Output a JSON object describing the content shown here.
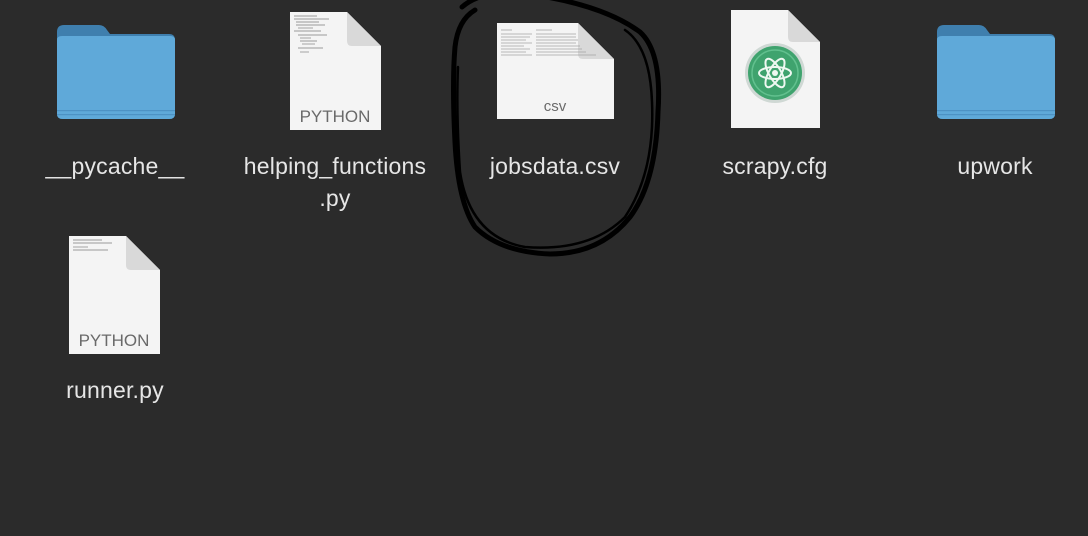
{
  "files": [
    {
      "name": "__pycache__",
      "kind": "folder",
      "icon": "folder-icon"
    },
    {
      "name_line1": "helping_functions",
      "name_line2": ".py",
      "kind": "python",
      "badge": "PYTHON",
      "icon": "python-document-icon"
    },
    {
      "name": "jobsdata.csv",
      "kind": "csv",
      "badge": "csv",
      "icon": "csv-document-icon",
      "annotated": true
    },
    {
      "name": "scrapy.cfg",
      "kind": "cfg",
      "icon": "atom-app-icon"
    },
    {
      "name": "upwork",
      "kind": "folder",
      "icon": "folder-icon"
    },
    {
      "name": "runner.py",
      "kind": "python",
      "badge": "PYTHON",
      "icon": "python-document-icon"
    }
  ],
  "colors": {
    "background": "#2b2b2b",
    "label": "#e6e6e6",
    "folder": "#5fa9d9",
    "annotation": "#000000",
    "atom_green": "#3fa36e"
  }
}
